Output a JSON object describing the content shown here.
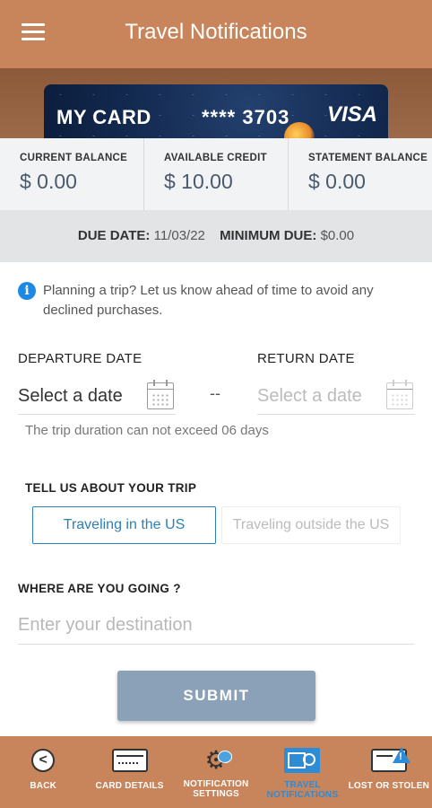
{
  "header": {
    "title": "Travel Notifications"
  },
  "card": {
    "name": "MY CARD",
    "number": "**** 3703",
    "brand": "VISA"
  },
  "balances": [
    {
      "label": "CURRENT BALANCE",
      "value": "$ 0.00"
    },
    {
      "label": "AVAILABLE CREDIT",
      "value": "$ 10.00"
    },
    {
      "label": "STATEMENT BALANCE",
      "value": "$ 0.00"
    }
  ],
  "due": {
    "date_label": "DUE DATE:",
    "date_value": "11/03/22",
    "min_label": "MINIMUM DUE:",
    "min_value": "$0.00"
  },
  "info": {
    "icon": "info-icon",
    "text": "Planning a trip? Let us know ahead of time to avoid any declined purchases."
  },
  "form": {
    "departure_label": "DEPARTURE DATE",
    "departure_placeholder": "Select a date",
    "separator": "--",
    "return_label": "RETURN DATE",
    "return_placeholder": "Select a date",
    "hint": "The trip duration can not exceed 06 days",
    "trip_label": "TELL US ABOUT YOUR TRIP",
    "option_us": "Traveling in the US",
    "option_outside": "Traveling outside the US",
    "selected_option": "Traveling in the US",
    "destination_label": "WHERE ARE YOU GOING ?",
    "destination_placeholder": "Enter your destination",
    "destination_value": "",
    "submit_label": "SUBMIT"
  },
  "nav": {
    "items": [
      {
        "label": "BACK",
        "icon": "back-icon"
      },
      {
        "label": "CARD DETAILS",
        "icon": "card-icon"
      },
      {
        "label": "NOTIFICATION SETTINGS",
        "icon": "gear-chat-icon"
      },
      {
        "label": "TRAVEL NOTIFICATIONS",
        "icon": "travel-icon"
      },
      {
        "label": "LOST OR STOLEN",
        "icon": "lost-card-icon"
      }
    ],
    "active": "TRAVEL NOTIFICATIONS"
  },
  "colors": {
    "header": "#c8845a",
    "accent": "#2c7fb8",
    "submit": "#8ba1b7",
    "nav_active": "#2e8bd6"
  }
}
